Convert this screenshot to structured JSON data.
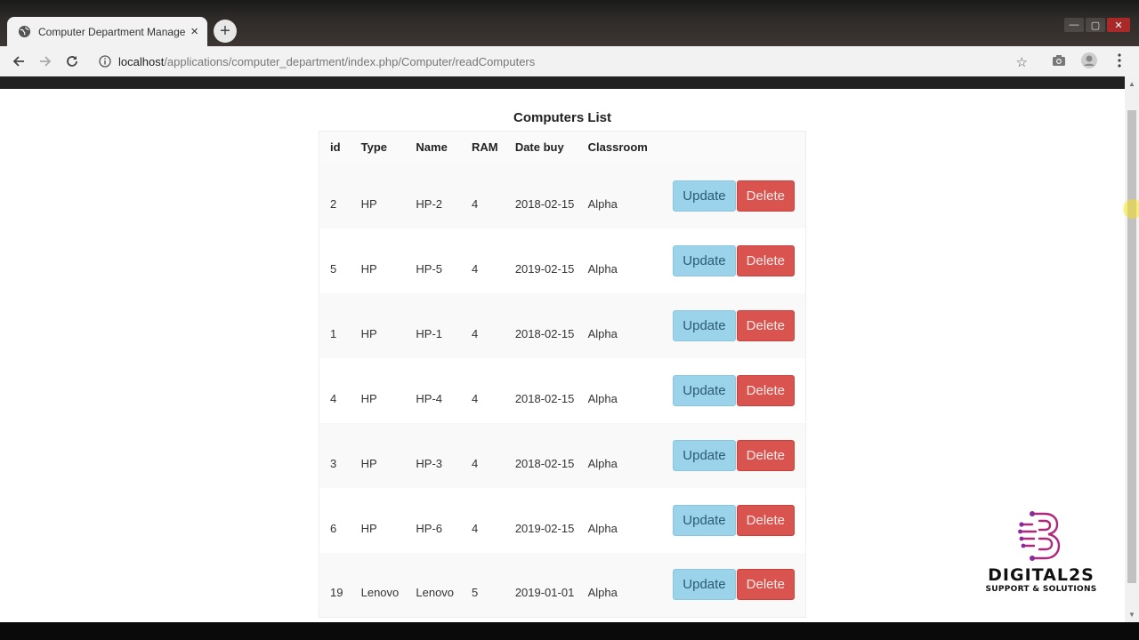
{
  "browser": {
    "tab_title": "Computer Department Management",
    "tab_close": "×",
    "new_tab": "+",
    "url_host": "localhost",
    "url_path": "/applications/computer_department/index.php/Computer/readComputers",
    "window_controls": {
      "minimize": "—",
      "maximize": "▢",
      "close": "✕"
    }
  },
  "page": {
    "title": "Computers List",
    "columns": [
      "id",
      "Type",
      "Name",
      "RAM",
      "Date buy",
      "Classroom"
    ],
    "rows": [
      {
        "id": "2",
        "type": "HP",
        "name": "HP-2",
        "ram": "4",
        "date": "2018-02-15",
        "classroom": "Alpha"
      },
      {
        "id": "5",
        "type": "HP",
        "name": "HP-5",
        "ram": "4",
        "date": "2019-02-15",
        "classroom": "Alpha"
      },
      {
        "id": "1",
        "type": "HP",
        "name": "HP-1",
        "ram": "4",
        "date": "2018-02-15",
        "classroom": "Alpha"
      },
      {
        "id": "4",
        "type": "HP",
        "name": "HP-4",
        "ram": "4",
        "date": "2018-02-15",
        "classroom": "Alpha"
      },
      {
        "id": "3",
        "type": "HP",
        "name": "HP-3",
        "ram": "4",
        "date": "2018-02-15",
        "classroom": "Alpha"
      },
      {
        "id": "6",
        "type": "HP",
        "name": "HP-6",
        "ram": "4",
        "date": "2019-02-15",
        "classroom": "Alpha"
      },
      {
        "id": "19",
        "type": "Lenovo",
        "name": "Lenovo",
        "ram": "5",
        "date": "2019-01-01",
        "classroom": "Alpha"
      }
    ],
    "update_label": "Update",
    "delete_label": "Delete"
  },
  "watermark": {
    "brand": "DIGITAL2S",
    "tagline": "SUPPORT & SOLUTIONS"
  },
  "colors": {
    "update_button": "#9bd3ea",
    "delete_button": "#d9534f",
    "logo_accent": "#b0267c"
  }
}
